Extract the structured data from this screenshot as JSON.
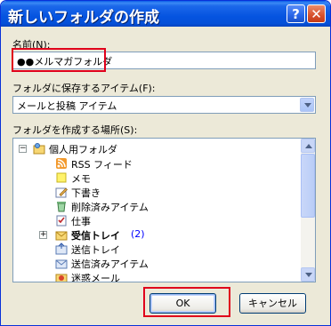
{
  "dialog": {
    "title": "新しいフォルダの作成",
    "help_label": "?",
    "close_label": "✕"
  },
  "name_field": {
    "label": "名前(N):",
    "value": "●●メルマガフォルダ"
  },
  "item_type": {
    "label": "フォルダに保存するアイテム(F):",
    "selected": "メールと投稿 アイテム"
  },
  "location": {
    "label": "フォルダを作成する場所(S):",
    "tree": [
      {
        "label": "個人用フォルダ",
        "icon": "personal-folders-icon",
        "expander": "−"
      },
      {
        "label": "RSS フィード",
        "icon": "rss-feed-icon"
      },
      {
        "label": "メモ",
        "icon": "notes-icon"
      },
      {
        "label": "下書き",
        "icon": "drafts-icon"
      },
      {
        "label": "削除済みアイテム",
        "icon": "deleted-items-icon"
      },
      {
        "label": "仕事",
        "icon": "tasks-icon"
      },
      {
        "label": "受信トレイ",
        "icon": "inbox-icon",
        "expander": "+",
        "count": "(2)"
      },
      {
        "label": "送信トレイ",
        "icon": "outbox-icon"
      },
      {
        "label": "送信済みアイテム",
        "icon": "sent-items-icon"
      },
      {
        "label": "迷惑メール",
        "icon": "junk-mail-icon"
      }
    ]
  },
  "buttons": {
    "ok": "OK",
    "cancel": "キャンセル"
  },
  "colors": {
    "title_bar": "#0554e0",
    "highlight": "#e0001b",
    "count": "#0000ff"
  }
}
